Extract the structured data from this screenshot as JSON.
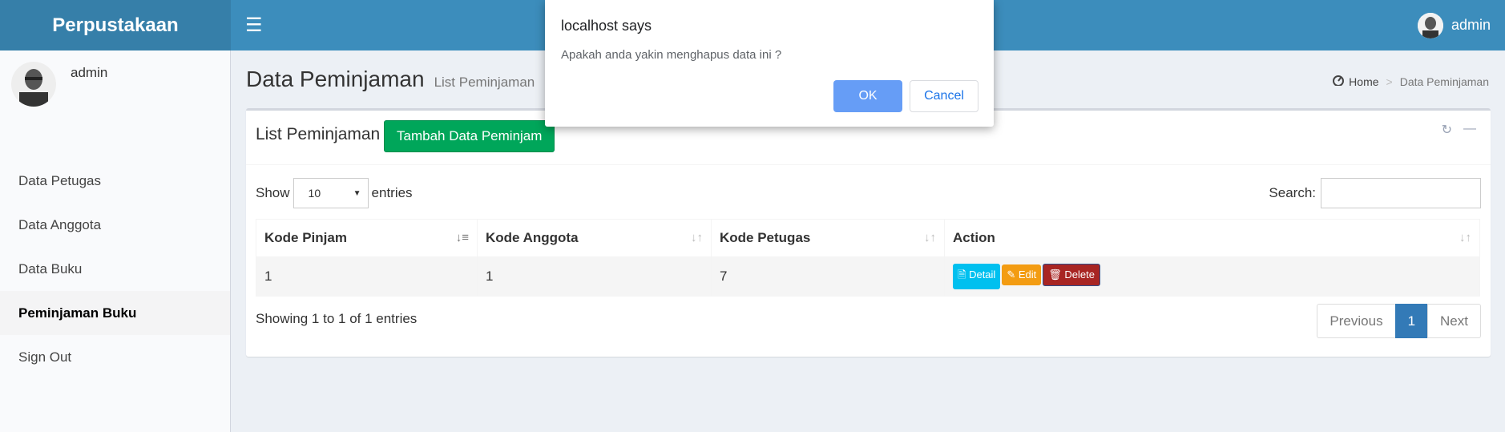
{
  "header": {
    "brand": "Perpustakaan",
    "user": "admin"
  },
  "sidebar": {
    "user_name": "admin",
    "items": [
      {
        "label": "Data Petugas"
      },
      {
        "label": "Data Anggota"
      },
      {
        "label": "Data Buku"
      },
      {
        "label": "Peminjaman Buku"
      },
      {
        "label": "Sign Out"
      }
    ]
  },
  "page": {
    "title": "Data Peminjaman",
    "subtitle": "List Peminjaman",
    "breadcrumb": {
      "home": "Home",
      "current": "Data Peminjaman"
    }
  },
  "box": {
    "title": "List Peminjaman",
    "add_button": "Tambah Data Peminjam"
  },
  "datatable": {
    "show_label": "Show",
    "entries_value": "10",
    "entries_label": "entries",
    "search_label": "Search:",
    "search_value": "",
    "columns": [
      "Kode Pinjam",
      "Kode Anggota",
      "Kode Petugas",
      "Action"
    ],
    "rows": [
      {
        "kode_pinjam": "1",
        "kode_anggota": "1",
        "kode_petugas": "7"
      }
    ],
    "actions": {
      "detail": "Detail",
      "edit": "Edit",
      "delete": "Delete"
    },
    "info": "Showing 1 to 1 of 1 entries",
    "pagination": {
      "previous": "Previous",
      "current": "1",
      "next": "Next"
    }
  },
  "dialog": {
    "title": "localhost says",
    "message": "Apakah anda yakin menghapus data ini ?",
    "ok": "OK",
    "cancel": "Cancel"
  },
  "colors": {
    "header": "#3c8dbc",
    "logo_bg": "#367fa9",
    "success": "#00a65a",
    "info": "#00c0ef",
    "warning": "#f39c12",
    "danger": "#a82523",
    "primary": "#337ab7"
  },
  "icons": [
    "hamburger-icon",
    "dashboard-icon",
    "refresh-icon",
    "minus-icon",
    "sort-icon",
    "file-icon",
    "pencil-icon",
    "trash-icon"
  ]
}
